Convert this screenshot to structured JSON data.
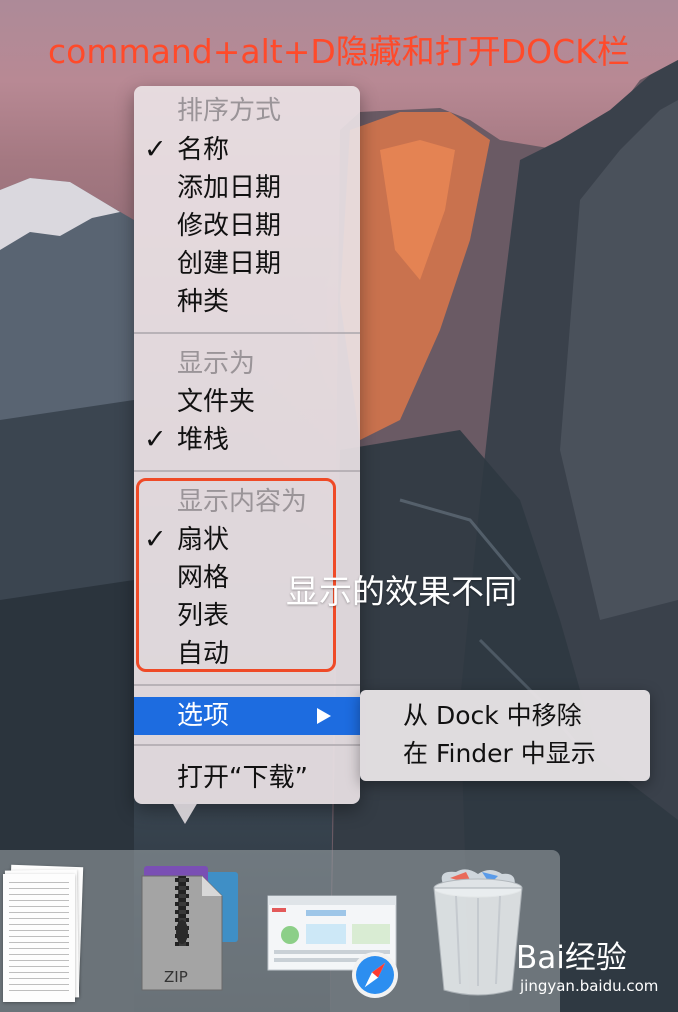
{
  "caption": {
    "headline": "command+alt+D隐藏和打开DOCK栏",
    "annotation": "显示的效果不同",
    "highlight_color": "#ef4a27"
  },
  "menu": {
    "sort_header": "排序方式",
    "sort_items": [
      "名称",
      "添加日期",
      "修改日期",
      "创建日期",
      "种类"
    ],
    "sort_checked": "名称",
    "display_as_header": "显示为",
    "display_as_items": [
      "文件夹",
      "堆栈"
    ],
    "display_as_checked": "堆栈",
    "content_header": "显示内容为",
    "content_items": [
      "扇状",
      "网格",
      "列表",
      "自动"
    ],
    "content_checked": "扇状",
    "options_label": "选项",
    "open_label": "打开“下载”",
    "check_mark": "✓",
    "highlight_color": "#1d6ce0"
  },
  "submenu": {
    "items": [
      "从 Dock 中移除",
      "在 Finder 中显示"
    ]
  },
  "dock": {
    "zip_label": "ZIP",
    "items": [
      "documents-stack",
      "downloads-zip-stack",
      "browser-stack",
      "trash"
    ]
  },
  "watermark": {
    "brand": "Bai经验",
    "url": "jingyan.baidu.com"
  }
}
